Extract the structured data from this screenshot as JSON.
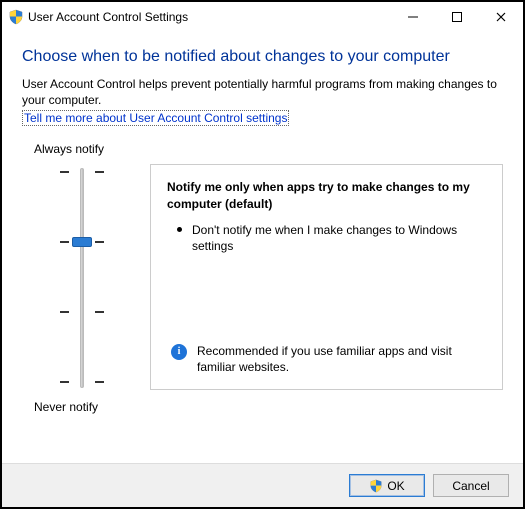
{
  "window": {
    "title": "User Account Control Settings"
  },
  "page": {
    "heading": "Choose when to be notified about changes to your computer",
    "description": "User Account Control helps prevent potentially harmful programs from making changes to your computer.",
    "link": "Tell me more about User Account Control settings"
  },
  "slider": {
    "top_label": "Always notify",
    "bottom_label": "Never notify",
    "levels": 4,
    "current_level_index": 1
  },
  "panel": {
    "title": "Notify me only when apps try to make changes to my computer (default)",
    "bullets": [
      "Don't notify me when I make changes to Windows settings"
    ],
    "recommendation": "Recommended if you use familiar apps and visit familiar websites."
  },
  "buttons": {
    "ok": "OK",
    "cancel": "Cancel"
  }
}
